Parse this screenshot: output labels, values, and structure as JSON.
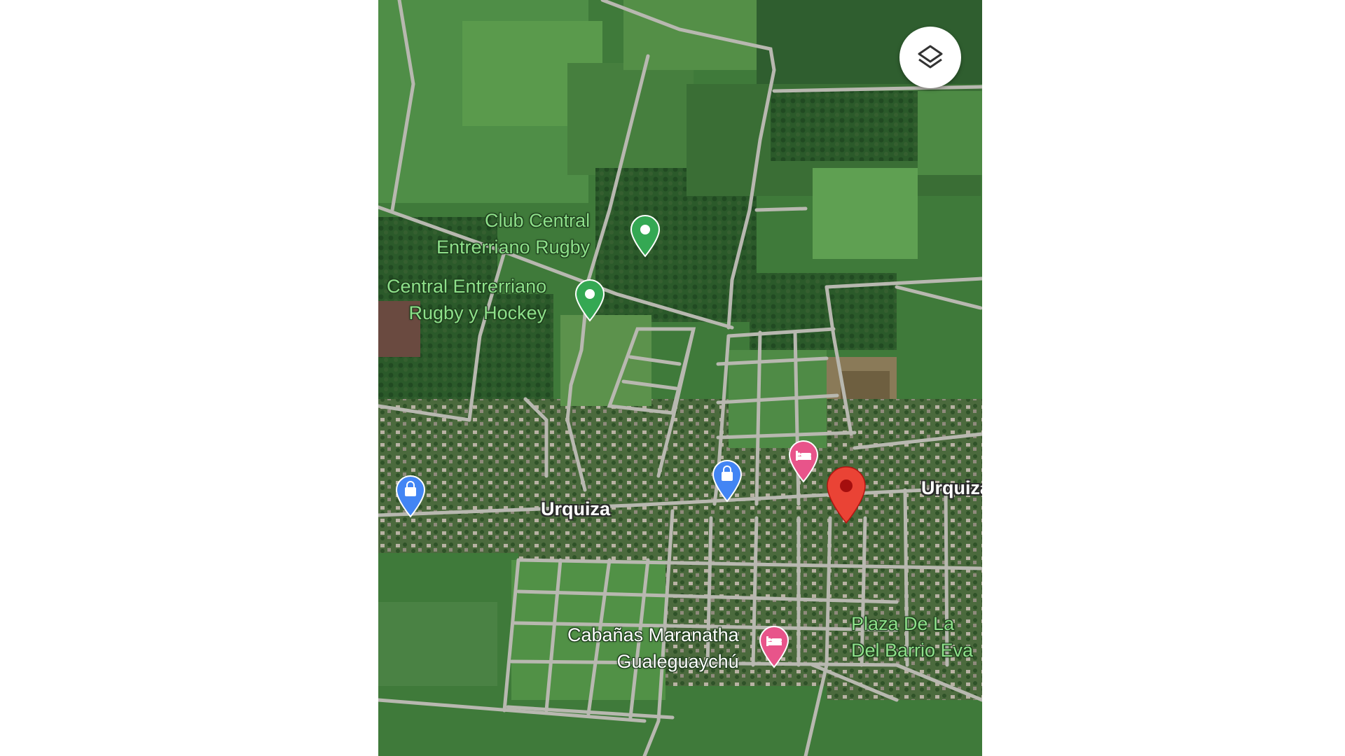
{
  "map": {
    "view": "satellite",
    "colors": {
      "road": "#b8b8b0",
      "road_outline": "#8d8d86",
      "park_pin": "#34a853",
      "shop_pin": "#4285f4",
      "hotel_pin": "#e8548a",
      "selected_pin": "#ea4335",
      "park_label": "#8ee08a"
    },
    "controls": {
      "layers_button": {
        "icon": "layers-icon"
      }
    },
    "places": [
      {
        "id": "club",
        "name": "Club Central\nEntrerriano Rugby",
        "category": "park",
        "icon": "park-pin-icon"
      },
      {
        "id": "central",
        "name": "Central Entrerriano\nRugby y Hockey",
        "category": "park",
        "icon": "park-pin-icon"
      },
      {
        "id": "cabanas",
        "name": "Cabañas Maranatha\nGualeguaychú",
        "category": "hotel",
        "icon": "hotel-pin-icon"
      },
      {
        "id": "plaza",
        "name": "Plaza De La\nDel Barrio Eva",
        "category": "park",
        "icon": "park-label"
      }
    ],
    "streets": [
      {
        "id": "urquiza-west",
        "name": "Urquiza"
      },
      {
        "id": "urquiza-east",
        "name": "Urquiza"
      }
    ],
    "markers": {
      "shopping_west": {
        "icon": "shopping-bag-pin-icon"
      },
      "shopping_center": {
        "icon": "shopping-bag-pin-icon"
      },
      "hotel_north": {
        "icon": "hotel-pin-icon"
      },
      "selected_location": {
        "icon": "selected-location-pin-icon"
      }
    }
  }
}
